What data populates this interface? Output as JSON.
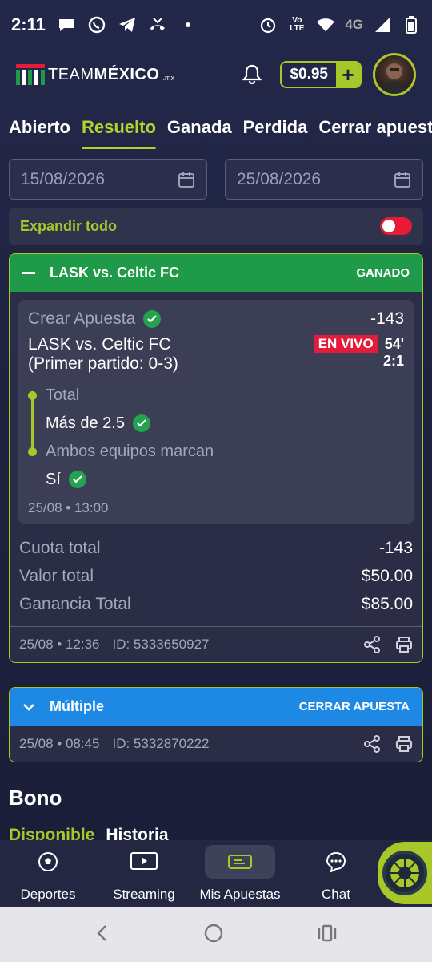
{
  "status_bar": {
    "time": "2:11",
    "network": "4G",
    "volte_top": "Vo",
    "volte_bottom": "LTE"
  },
  "header": {
    "logo_thin": "TEAM",
    "logo_bold": "MÉXICO",
    "logo_suffix": ".mx",
    "balance": "$0.95",
    "add_symbol": "+"
  },
  "tabs": [
    "Abierto",
    "Resuelto",
    "Ganada",
    "Perdida",
    "Cerrar apuesta"
  ],
  "active_tab": "Resuelto",
  "date_range": {
    "from": "15/08/2026",
    "to": "25/08/2026"
  },
  "expand_all": {
    "label": "Expandir todo",
    "on": false
  },
  "bets": [
    {
      "title": "LASK vs. Celtic FC",
      "status": "GANADO",
      "selection": {
        "type_label": "Crear Apuesta",
        "odds": "-143",
        "match_line1": "LASK vs. Celtic FC",
        "match_line2": "(Primer partido: 0-3)",
        "live_label": "EN VIVO",
        "minute": "54'",
        "score": "2:1",
        "legs": [
          {
            "market": "Total",
            "pick": "Más de 2.5"
          },
          {
            "market": "Ambos equipos marcan",
            "pick": "Sí"
          }
        ],
        "event_time": "25/08 • 13:00"
      },
      "summary": [
        {
          "label": "Cuota total",
          "value": "-143"
        },
        {
          "label": "Valor total",
          "value": "$50.00"
        },
        {
          "label": "Ganancia Total",
          "value": "$85.00"
        }
      ],
      "placed_at": "25/08 • 12:36",
      "bet_id": "ID: 5333650927"
    },
    {
      "title": "Múltiple",
      "status": "CERRAR APUESTA",
      "placed_at": "25/08 • 08:45",
      "bet_id": "ID: 5332870222"
    }
  ],
  "bono": {
    "title": "Bono",
    "tabs": [
      "Disponible",
      "Historia"
    ]
  },
  "bottom_nav": [
    {
      "label": "Deportes",
      "icon": "soccer-ball-icon"
    },
    {
      "label": "Streaming",
      "icon": "play-icon"
    },
    {
      "label": "Mis Apuestas",
      "icon": "ticket-icon"
    },
    {
      "label": "Chat",
      "icon": "chat-icon"
    }
  ],
  "colors": {
    "accent": "#a8c82a",
    "won": "#1f9a48",
    "multiple": "#1e88e5",
    "live": "#e41b3a",
    "background": "#1f2341"
  }
}
